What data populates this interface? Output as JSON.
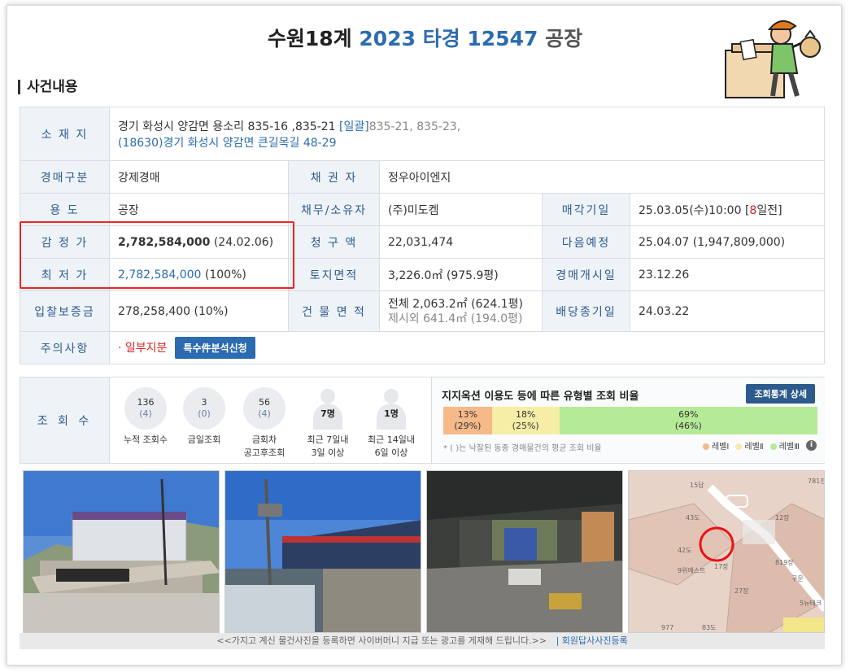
{
  "header": {
    "court": "수원18계",
    "case_no": "2023 타경 12547",
    "type": "공장"
  },
  "section_title": "사건내용",
  "info": {
    "location_label": "소 재 지",
    "address_main": "경기 화성시 양감면 용소리 835-16 ,835-21",
    "address_bulk_link": "[일괄]",
    "address_bulk": "835-21, 835-23,",
    "address_road": "(18630)경기 화성시  양감면 큰길목길  48-29",
    "auction_type_label": "경매구분",
    "auction_type": "강제경매",
    "creditor_label": "채 권 자",
    "creditor": "정우아이엔지",
    "usage_label": "용      도",
    "usage": "공장",
    "debtor_label": "채무/소유자",
    "debtor": "(주)미도켐",
    "sale_date_label": "매각기일",
    "sale_date": "25.03.05(수)10:00 [",
    "sale_date_days": "8",
    "sale_date_suffix": "일전]",
    "appraisal_label": "감 정 가",
    "appraisal_value": "2,782,584,000",
    "appraisal_date": "(24.02.06)",
    "claim_label": "청 구 액",
    "claim": "22,031,474",
    "next_label": "다음예정",
    "next": "25.04.07 (1,947,809,000)",
    "min_label": "최 저 가",
    "min_value": "2,782,584,000",
    "min_pct": "(100%)",
    "land_label": "토지면적",
    "land": "3,226.0㎡ (975.9평)",
    "start_label": "경매개시일",
    "start": "23.12.26",
    "deposit_label": "입찰보증금",
    "deposit": "278,258,400 (10%)",
    "building_label": "건 물 면 적",
    "building_total": "전체 2,063.2㎡ (624.1평)",
    "building_excl": "제시외 641.4㎡ (194.0평)",
    "dividend_label": "배당종기일",
    "dividend": "24.03.22",
    "caution_label": "주의사항",
    "caution": "· 일부지분",
    "special_button": "특수件분석신청"
  },
  "views": {
    "label": "조 회 수",
    "stats": [
      {
        "main": "136",
        "sub": "(4)",
        "caption1": "누적 조회수",
        "caption2": ""
      },
      {
        "main": "3",
        "sub": "(0)",
        "caption1": "금일조회",
        "caption2": ""
      },
      {
        "main": "56",
        "sub": "(4)",
        "caption1": "금회차",
        "caption2": "공고후조회"
      }
    ],
    "people": [
      {
        "count": "7명",
        "caption1": "최근 7일내",
        "caption2": "3일 이상"
      },
      {
        "count": "1명",
        "caption1": "최근 14일내",
        "caption2": "6일 이상"
      }
    ],
    "ratio_title": "지지옥션 이용도 등에 따른 유형별 조회 비율",
    "ratio_button": "조회통계 상세",
    "segments": [
      {
        "pct": "13%",
        "avg": "(29%)",
        "share": 0.13
      },
      {
        "pct": "18%",
        "avg": "(25%)",
        "share": 0.18
      },
      {
        "pct": "69%",
        "avg": "(46%)",
        "share": 0.69
      }
    ],
    "note": "* ( )는 낙찰된 동종 경매물건의 평균 조회 비율",
    "legend": [
      "레벨Ⅰ",
      "레벨Ⅱ",
      "레벨Ⅲ"
    ],
    "legend_colors": [
      "#f5b98a",
      "#f6eea7",
      "#b5ea97"
    ]
  },
  "photos": [
    {
      "name": "building-exterior-photo"
    },
    {
      "name": "building-side-photo"
    },
    {
      "name": "factory-interior-photo"
    },
    {
      "name": "location-map-photo"
    }
  ],
  "map_labels": [
    "15답",
    "43도",
    "42도",
    "41전",
    "9위에스트",
    "17장",
    "27장",
    "18전",
    "819장",
    "구문",
    "5뉴테크",
    "977",
    "83도",
    "781전",
    "28장",
    "12장"
  ],
  "footer": {
    "notice": "<<가지고 계신 물건사진을 등록하면 사이버머니 지급 또는 광고를 게재해 드립니다.>>",
    "register": "| 회원답사사진등록"
  }
}
